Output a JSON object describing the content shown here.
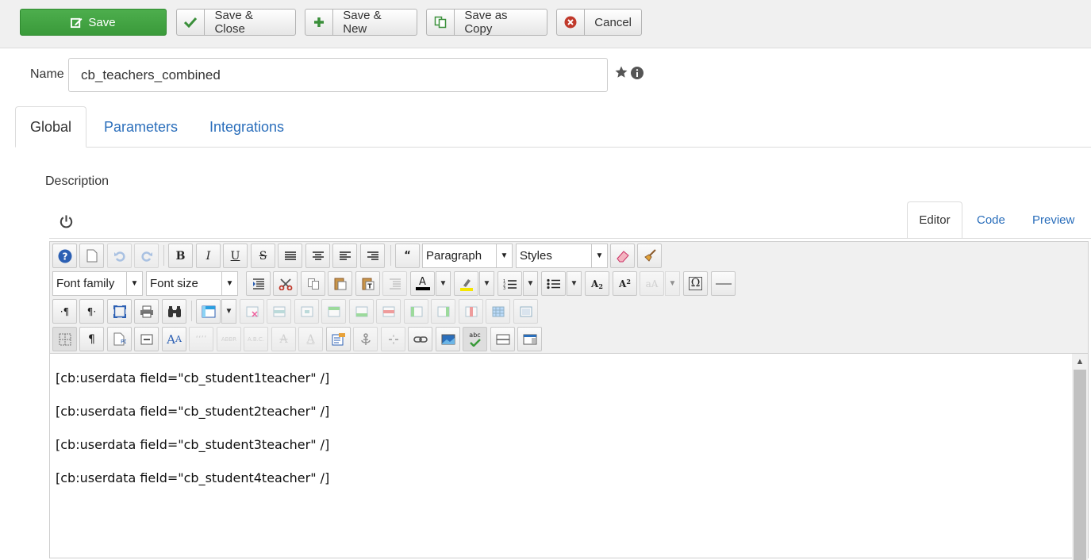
{
  "toolbar": {
    "save": "Save",
    "save_close": "Save & Close",
    "save_new": "Save & New",
    "save_copy": "Save as Copy",
    "cancel": "Cancel"
  },
  "form": {
    "name_label": "Name",
    "name_value": "cb_teachers_combined"
  },
  "tabs": [
    "Global",
    "Parameters",
    "Integrations"
  ],
  "description_label": "Description",
  "editor_tabs": [
    "Editor",
    "Code",
    "Preview"
  ],
  "editor_toolbar": {
    "paragraph": "Paragraph",
    "styles": "Styles",
    "font_family": "Font family",
    "font_size": "Font size"
  },
  "content_lines": [
    "[cb:userdata field=\"cb_student1teacher\" /]",
    "[cb:userdata field=\"cb_student2teacher\" /]",
    "[cb:userdata field=\"cb_student3teacher\" /]",
    "[cb:userdata field=\"cb_student4teacher\" /]"
  ],
  "colors": {
    "save_green": "#3fa33f",
    "link_blue": "#2a6ebb",
    "cancel_red": "#c0392b"
  }
}
